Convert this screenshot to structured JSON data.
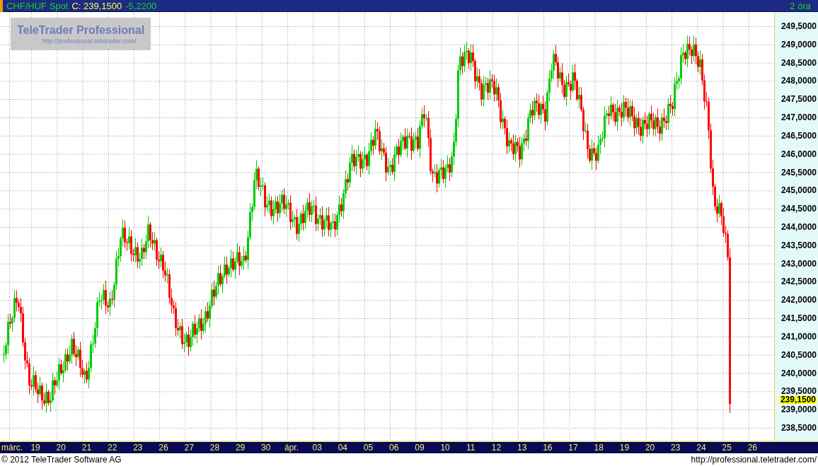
{
  "header": {
    "instrument": "CHF/HUF Spot",
    "close": "C: 239,1500",
    "change": "-5,2200",
    "interval": "2 óra"
  },
  "logo": {
    "title": "TeleTrader Professional",
    "url": "http://professional.teletrader.com/"
  },
  "y_axis": {
    "ticks": [
      "249,5000",
      "249,0000",
      "248,5000",
      "248,0000",
      "247,5000",
      "247,0000",
      "246,5000",
      "246,0000",
      "245,5000",
      "245,0000",
      "244,5000",
      "244,0000",
      "243,5000",
      "243,0000",
      "242,5000",
      "242,0000",
      "241,5000",
      "241,0000",
      "240,5000",
      "240,0000",
      "239,5000",
      "239,0000",
      "238,5000"
    ],
    "last_price": "239,1500"
  },
  "x_axis": {
    "labels": [
      "márc.",
      "19",
      "20",
      "21",
      "22",
      "23",
      "26",
      "27",
      "28",
      "29",
      "30",
      "ápr.",
      "03",
      "04",
      "05",
      "06",
      "09",
      "10",
      "11",
      "12",
      "13",
      "16",
      "17",
      "18",
      "19",
      "20",
      "23",
      "24",
      "25",
      "26"
    ]
  },
  "footer": {
    "copyright": "© 2012 TeleTrader Software AG",
    "url": "http://professional.teletrader.com/"
  }
}
